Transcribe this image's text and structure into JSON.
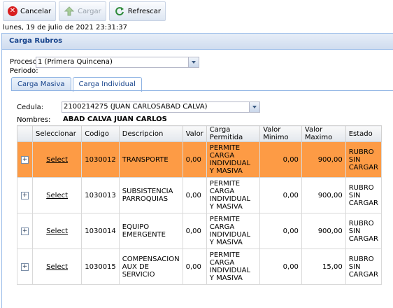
{
  "toolbar": {
    "cancel_label": "Cancelar",
    "load_label": "Cargar",
    "refresh_label": "Refrescar"
  },
  "datetime": "lunes, 19 de julio de 2021 23:31:37",
  "panel": {
    "title": "Carga Rubros"
  },
  "proceso": {
    "label": "Proceso:",
    "value": "1 (Primera Quincena)"
  },
  "periodo": {
    "label": "Periodo:"
  },
  "tabs": [
    {
      "label": "Carga Masiva",
      "active": false
    },
    {
      "label": "Carga Individual",
      "active": true
    }
  ],
  "cedula": {
    "label": "Cedula:",
    "value": "2100214275 (JUAN CARLOSABAD CALVA)"
  },
  "nombres": {
    "label": "Nombres:",
    "value": "ABAD CALVA JUAN CARLOS"
  },
  "grid": {
    "columns": [
      "Seleccionar",
      "Codigo",
      "Descripcion",
      "Valor",
      "Carga Permitida",
      "Valor Minimo",
      "Valor Maximo",
      "Estado"
    ],
    "rows": [
      {
        "select": "Select",
        "codigo": "1030012",
        "descripcion": "TRANSPORTE",
        "valor": "0,00",
        "carga": "PERMITE CARGA INDIVIDUAL Y MASIVA",
        "minimo": "0,00",
        "maximo": "900,00",
        "estado": "RUBRO SIN CARGAR",
        "selected": true
      },
      {
        "select": "Select",
        "codigo": "1030013",
        "descripcion": "SUBSISTENCIA PARROQUIAS",
        "valor": "0,00",
        "carga": "PERMITE CARGA INDIVIDUAL Y MASIVA",
        "minimo": "0,00",
        "maximo": "900,00",
        "estado": "RUBRO SIN CARGAR",
        "selected": false
      },
      {
        "select": "Select",
        "codigo": "1030014",
        "descripcion": "EQUIPO EMERGENTE",
        "valor": "0,00",
        "carga": "PERMITE CARGA INDIVIDUAL Y MASIVA",
        "minimo": "0,00",
        "maximo": "900,00",
        "estado": "RUBRO SIN CARGAR",
        "selected": false
      },
      {
        "select": "Select",
        "codigo": "1030015",
        "descripcion": "COMPENSACION AUX DE SERVICIO",
        "valor": "0,00",
        "carga": "PERMITE CARGA INDIVIDUAL Y MASIVA",
        "minimo": "0,00",
        "maximo": "15,00",
        "estado": "RUBRO SIN CARGAR",
        "selected": false
      }
    ]
  },
  "colors": {
    "selected_row": "#fd9b45",
    "header_text": "#15428b"
  }
}
